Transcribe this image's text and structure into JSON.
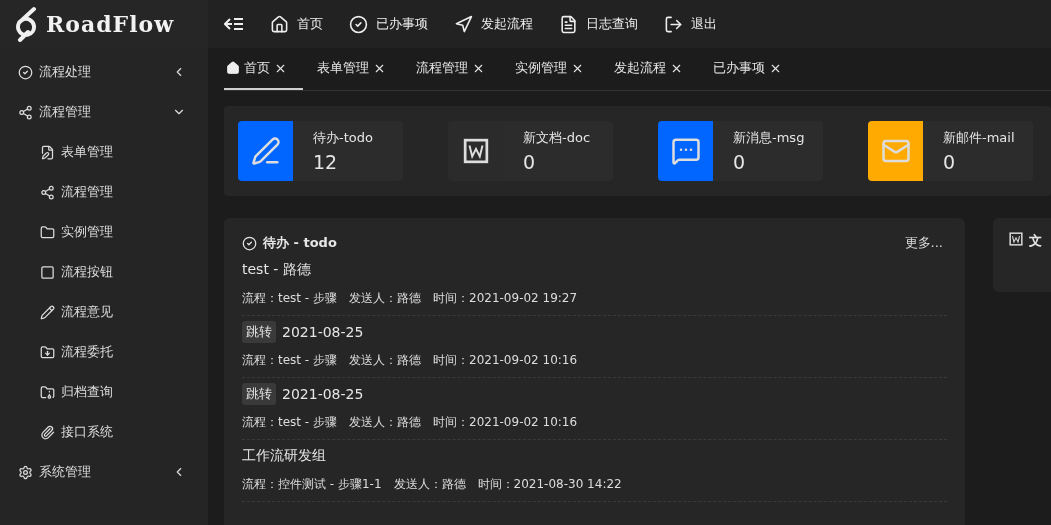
{
  "logo": {
    "text": "RoadFlow"
  },
  "topnav": [
    {
      "label": "首页"
    },
    {
      "label": "已办事项"
    },
    {
      "label": "发起流程"
    },
    {
      "label": "日志查询"
    },
    {
      "label": "退出"
    }
  ],
  "sidebar": {
    "items": [
      {
        "label": "流程处理",
        "expanded": false
      },
      {
        "label": "流程管理",
        "expanded": true,
        "children": [
          {
            "label": "表单管理"
          },
          {
            "label": "流程管理"
          },
          {
            "label": "实例管理"
          },
          {
            "label": "流程按钮"
          },
          {
            "label": "流程意见"
          },
          {
            "label": "流程委托"
          },
          {
            "label": "归档查询"
          },
          {
            "label": "接口系统"
          }
        ]
      },
      {
        "label": "系统管理",
        "expanded": false
      }
    ]
  },
  "tabs": [
    {
      "label": "首页",
      "selected": true
    },
    {
      "label": "表单管理",
      "selected": false
    },
    {
      "label": "流程管理",
      "selected": false
    },
    {
      "label": "实例管理",
      "selected": false
    },
    {
      "label": "发起流程",
      "selected": false
    },
    {
      "label": "已办事项",
      "selected": false
    }
  ],
  "stats": [
    {
      "label": "待办-todo",
      "count": "12",
      "color": "#0066ff"
    },
    {
      "label": "新文档-doc",
      "count": "0",
      "color": "#2b2b2b"
    },
    {
      "label": "新消息-msg",
      "count": "0",
      "color": "#0066ff"
    },
    {
      "label": "新邮件-mail",
      "count": "0",
      "color": "#ffaa00"
    }
  ],
  "todo_panel": {
    "title": "待办 - todo",
    "more": "更多...",
    "items": [
      {
        "title": "test - 路德",
        "meta": "流程：test - 步骤　发送人：路德　时间：2021-09-02 19:27"
      },
      {
        "tag": "跳转",
        "title": "2021-08-25",
        "meta": "流程：test - 步骤　发送人：路德　时间：2021-09-02 10:16"
      },
      {
        "tag": "跳转",
        "title": "2021-08-25",
        "meta": "流程：test - 步骤　发送人：路德　时间：2021-09-02 10:16"
      },
      {
        "title": "工作流研发组",
        "meta": "流程：控件测试 - 步骤1-1　发送人：路德　时间：2021-08-30 14:22"
      }
    ]
  },
  "doc_panel": {
    "title": "文"
  }
}
